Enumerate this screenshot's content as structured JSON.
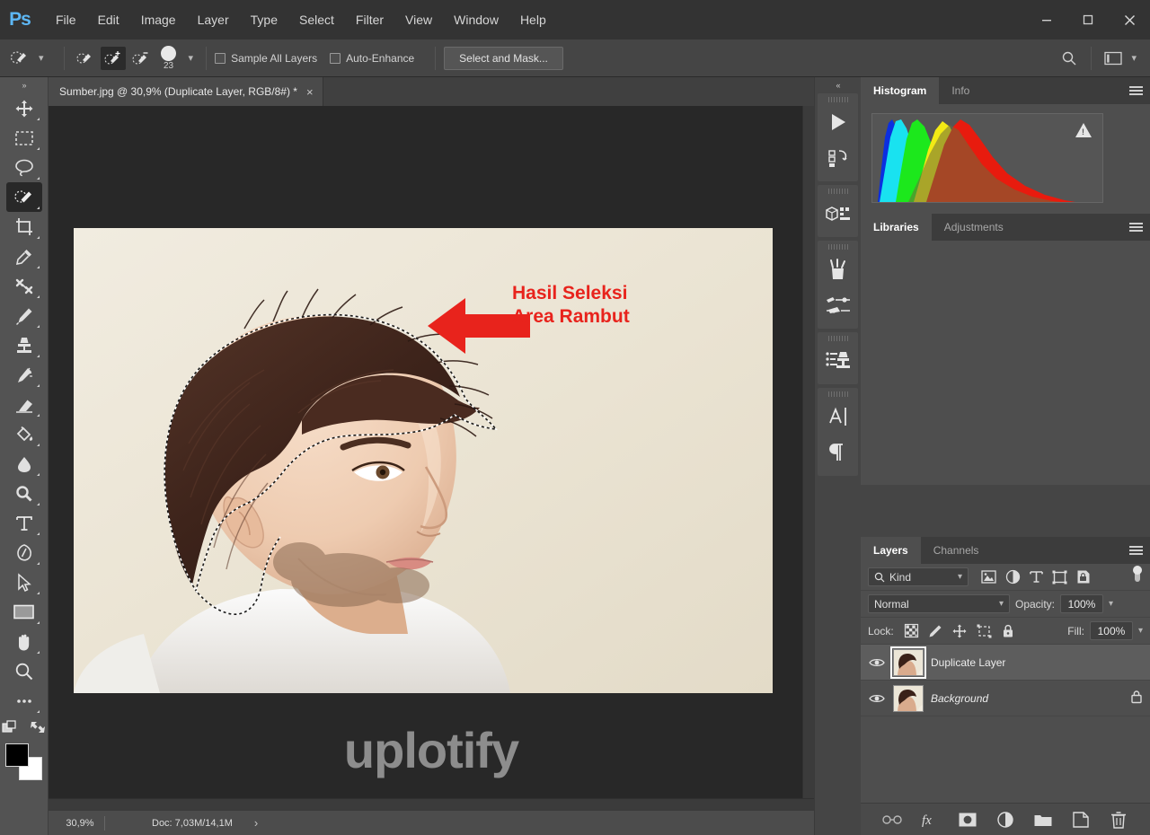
{
  "app": {
    "logo": "Ps",
    "name": "Adobe Photoshop"
  },
  "menubar": {
    "items": [
      {
        "label": "File",
        "name": "menu-file"
      },
      {
        "label": "Edit",
        "name": "menu-edit"
      },
      {
        "label": "Image",
        "name": "menu-image"
      },
      {
        "label": "Layer",
        "name": "menu-layer"
      },
      {
        "label": "Type",
        "name": "menu-type"
      },
      {
        "label": "Select",
        "name": "menu-select"
      },
      {
        "label": "Filter",
        "name": "menu-filter"
      },
      {
        "label": "View",
        "name": "menu-view"
      },
      {
        "label": "Window",
        "name": "menu-window"
      },
      {
        "label": "Help",
        "name": "menu-help"
      }
    ]
  },
  "window_controls": {
    "minimize": "minimize-icon",
    "maximize": "maximize-icon",
    "close": "close-icon"
  },
  "options_bar": {
    "tool_preset_icon": "quick-selection-tool-icon",
    "modes": [
      {
        "name": "new-selection-mode",
        "icon": "quick-selection-new-icon",
        "active": false
      },
      {
        "name": "add-to-selection-mode",
        "icon": "quick-selection-add-icon",
        "active": true
      },
      {
        "name": "subtract-from-selection-mode",
        "icon": "quick-selection-subtract-icon",
        "active": false
      }
    ],
    "brush_size": "23",
    "sample_all_layers": {
      "label": "Sample All Layers",
      "checked": false
    },
    "auto_enhance": {
      "label": "Auto-Enhance",
      "checked": false
    },
    "select_and_mask": "Select and Mask...",
    "search_icon": "search-icon",
    "workspace_icon": "workspace-switcher-icon"
  },
  "toolbar": {
    "expand": "»",
    "tools": [
      {
        "name": "move-tool",
        "icon": "move-icon",
        "active": false
      },
      {
        "name": "rectangular-marquee-tool",
        "icon": "marquee-icon",
        "active": false
      },
      {
        "name": "lasso-tool",
        "icon": "lasso-icon",
        "active": false
      },
      {
        "name": "quick-selection-tool",
        "icon": "quick-selection-icon",
        "active": true
      },
      {
        "name": "crop-tool",
        "icon": "crop-icon",
        "active": false
      },
      {
        "name": "eyedropper-tool",
        "icon": "eyedropper-icon",
        "active": false
      },
      {
        "name": "spot-healing-brush-tool",
        "icon": "healing-icon",
        "active": false
      },
      {
        "name": "brush-tool",
        "icon": "brush-icon",
        "active": false
      },
      {
        "name": "clone-stamp-tool",
        "icon": "stamp-icon",
        "active": false
      },
      {
        "name": "history-brush-tool",
        "icon": "history-brush-icon",
        "active": false
      },
      {
        "name": "eraser-tool",
        "icon": "eraser-icon",
        "active": false
      },
      {
        "name": "gradient-tool",
        "icon": "paint-bucket-icon",
        "active": false
      },
      {
        "name": "blur-tool",
        "icon": "blur-icon",
        "active": false
      },
      {
        "name": "dodge-tool",
        "icon": "dodge-icon",
        "active": false
      },
      {
        "name": "type-tool",
        "icon": "type-icon",
        "active": false
      },
      {
        "name": "pen-tool",
        "icon": "pen-icon",
        "active": false
      },
      {
        "name": "path-selection-tool",
        "icon": "path-arrow-icon",
        "active": false
      },
      {
        "name": "rectangle-tool",
        "icon": "rectangle-icon",
        "active": false
      },
      {
        "name": "hand-tool",
        "icon": "hand-icon",
        "active": false
      },
      {
        "name": "zoom-tool",
        "icon": "magnifier-icon",
        "active": false
      },
      {
        "name": "edit-toolbar",
        "icon": "ellipsis-icon",
        "active": false
      }
    ],
    "quick_mask_icon": "quick-mask-icon",
    "screen_mode_icon": "screen-mode-icon",
    "foreground_color": "#000000",
    "background_color": "#ffffff"
  },
  "document": {
    "tab_title": "Sumber.jpg @ 30,9% (Duplicate Layer, RGB/8#) *",
    "close_glyph": "×"
  },
  "canvas": {
    "annotation_line1": "Hasil Seleksi",
    "annotation_line2": "Area Rambut",
    "annotation_color": "#e8231c",
    "arrow_icon": "left-arrow-annotation-icon",
    "watermark": "uplotify",
    "background_color": "#282828"
  },
  "status_bar": {
    "zoom": "30,9%",
    "doc": "Doc: 7,03M/14,1M",
    "expand_glyph": "›"
  },
  "icon_strip": {
    "collapse": "«",
    "groups": [
      {
        "icons": [
          {
            "name": "play-actions-icon"
          },
          {
            "name": "history-states-icon"
          }
        ]
      },
      {
        "icons": [
          {
            "name": "3d-panel-icon"
          }
        ]
      },
      {
        "icons": [
          {
            "name": "brush-presets-icon"
          },
          {
            "name": "brush-settings-icon"
          }
        ]
      },
      {
        "icons": [
          {
            "name": "tool-presets-icon"
          }
        ]
      },
      {
        "icons": [
          {
            "name": "character-panel-icon"
          },
          {
            "name": "paragraph-panel-icon"
          }
        ]
      }
    ]
  },
  "histogram_panel": {
    "tabs": [
      {
        "label": "Histogram",
        "active": true
      },
      {
        "label": "Info",
        "active": false
      }
    ],
    "menu_icon": "panel-menu-icon",
    "warning_icon": "cached-data-warning-icon"
  },
  "libraries_panel": {
    "tabs": [
      {
        "label": "Libraries",
        "active": true
      },
      {
        "label": "Adjustments",
        "active": false
      }
    ],
    "menu_icon": "panel-menu-icon"
  },
  "layers_panel": {
    "tabs": [
      {
        "label": "Layers",
        "active": true
      },
      {
        "label": "Channels",
        "active": false
      }
    ],
    "menu_icon": "panel-menu-icon",
    "filter": {
      "kind_label": "Kind",
      "search_icon": "search-icon",
      "chevron": "⌄",
      "type_filters": [
        {
          "name": "filter-pixel-layers-icon"
        },
        {
          "name": "filter-adjustment-layers-icon"
        },
        {
          "name": "filter-type-layers-icon"
        },
        {
          "name": "filter-shape-layers-icon"
        },
        {
          "name": "filter-smart-object-icon"
        }
      ],
      "toggle_name": "filter-toggle-switch"
    },
    "blend_mode": "Normal",
    "opacity_label": "Opacity:",
    "opacity_value": "100%",
    "lock_label": "Lock:",
    "lock_icons": [
      {
        "name": "lock-transparent-pixels-icon"
      },
      {
        "name": "lock-image-pixels-icon"
      },
      {
        "name": "lock-position-icon"
      },
      {
        "name": "lock-artboard-nesting-icon"
      },
      {
        "name": "lock-all-icon"
      }
    ],
    "fill_label": "Fill:",
    "fill_value": "100%",
    "layers": [
      {
        "name": "Duplicate Layer",
        "visible": true,
        "selected": true,
        "locked": false,
        "italic": false
      },
      {
        "name": "Background",
        "visible": true,
        "selected": false,
        "locked": true,
        "italic": true
      }
    ],
    "footer_icons": [
      {
        "name": "link-layers-icon"
      },
      {
        "name": "layer-style-fx-icon"
      },
      {
        "name": "add-layer-mask-icon"
      },
      {
        "name": "new-adjustment-layer-icon"
      },
      {
        "name": "new-group-icon"
      },
      {
        "name": "new-layer-icon"
      },
      {
        "name": "delete-layer-icon"
      }
    ]
  }
}
